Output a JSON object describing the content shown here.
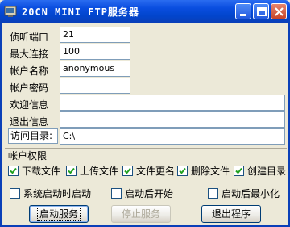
{
  "window": {
    "title": "20CN MINI FTP服务器",
    "title_icon": "ftp-app-icon",
    "controls": [
      "minimize-icon",
      "maximize-icon",
      "close-icon"
    ]
  },
  "fields": {
    "port": {
      "label": "侦听端口",
      "value": "21"
    },
    "max_conn": {
      "label": "最大连接",
      "value": "100"
    },
    "account_name": {
      "label": "帐户名称",
      "value": "anonymous"
    },
    "account_password": {
      "label": "帐户密码",
      "value": ""
    },
    "welcome": {
      "label": "欢迎信息",
      "value": ""
    },
    "exit_msg": {
      "label": "退出信息",
      "value": ""
    },
    "access_dir": {
      "label": "访问目录:",
      "value": "C:\\"
    }
  },
  "permissions": {
    "title": "帐户权限",
    "items": [
      {
        "label": "下载文件",
        "checked": true
      },
      {
        "label": "上传文件",
        "checked": true
      },
      {
        "label": "文件更名",
        "checked": true
      },
      {
        "label": "删除文件",
        "checked": true
      },
      {
        "label": "创建目录",
        "checked": true
      }
    ]
  },
  "options": [
    {
      "label": "系统启动时启动",
      "checked": false
    },
    {
      "label": "启动后开始",
      "checked": false
    },
    {
      "label": "启动后最小化",
      "checked": false
    }
  ],
  "buttons": {
    "start": "启动服务",
    "stop": "停止服务",
    "exit": "退出程序"
  },
  "colors": {
    "titlebar": "#0245cc",
    "window_bg": "#ece9d8",
    "field_border": "#7f9db9"
  }
}
